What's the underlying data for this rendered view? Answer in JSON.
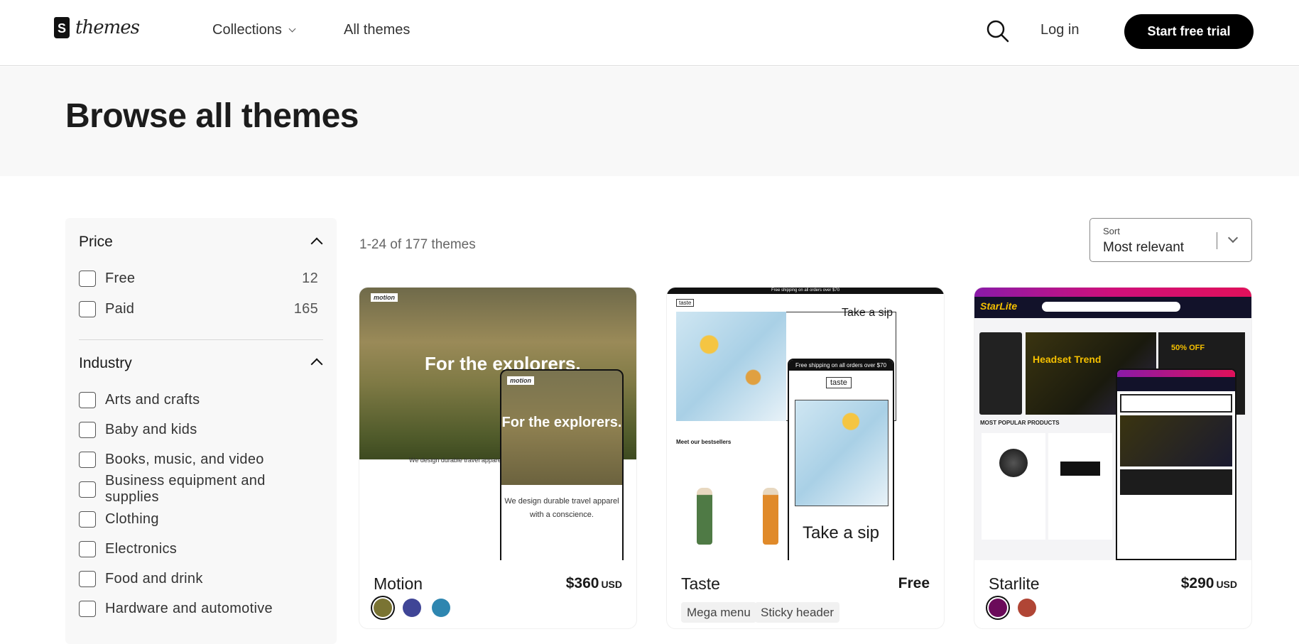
{
  "header": {
    "logo_text": "themes",
    "nav": [
      {
        "label": "Collections"
      },
      {
        "label": "All themes"
      }
    ],
    "login": "Log in",
    "cta": "Start free trial"
  },
  "hero": {
    "title": "Browse all themes"
  },
  "filters": {
    "price": {
      "title": "Price",
      "options": [
        {
          "label": "Free",
          "count": "12"
        },
        {
          "label": "Paid",
          "count": "165"
        }
      ]
    },
    "industry": {
      "title": "Industry",
      "options": [
        {
          "label": "Arts and crafts"
        },
        {
          "label": "Baby and kids"
        },
        {
          "label": "Books, music, and video"
        },
        {
          "label": "Business equipment and supplies"
        },
        {
          "label": "Clothing"
        },
        {
          "label": "Electronics"
        },
        {
          "label": "Food and drink"
        },
        {
          "label": "Hardware and automotive"
        }
      ]
    }
  },
  "results": {
    "count": "1-24 of 177 themes"
  },
  "sort": {
    "label": "Sort",
    "value": "Most relevant"
  },
  "themes": [
    {
      "name": "Motion",
      "price": "$360",
      "currency": "USD",
      "preview": {
        "headline": "For the explorers.",
        "mobile_headline": "For the explorers.",
        "subtext": "We design durable travel apparel with a conscience.",
        "logo": "motion"
      },
      "swatches": [
        "#7a7433",
        "#3f4596",
        "#2e86b0"
      ]
    },
    {
      "name": "Taste",
      "price": "Free",
      "preview": {
        "banner": "Free shipping on all orders over $70",
        "headline": "Take a sip",
        "section": "Meet our bestsellers",
        "logo": "taste"
      },
      "tags": [
        "Mega menu",
        "Sticky header"
      ]
    },
    {
      "name": "Starlite",
      "price": "$290",
      "currency": "USD",
      "preview": {
        "logo": "StarLite",
        "headline": "Headset Trend",
        "sale": "50% OFF",
        "section": "MOST POPULAR PRODUCTS"
      },
      "swatches": [
        "#6b0a5a",
        "#b04535"
      ]
    }
  ]
}
